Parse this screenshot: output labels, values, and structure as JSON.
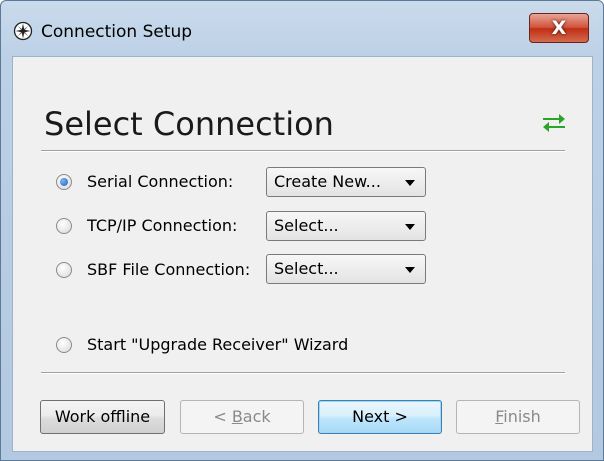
{
  "window": {
    "title": "Connection Setup",
    "close_label": "X",
    "heading": "Select Connection"
  },
  "icons": {
    "app": "compass-rose-icon",
    "swap": "swap-arrows-icon",
    "swap_color": "#2aa52a"
  },
  "options": [
    {
      "label": "Serial Connection:",
      "selected": true,
      "combo_value": "Create New..."
    },
    {
      "label": "TCP/IP Connection:",
      "selected": false,
      "combo_value": "Select..."
    },
    {
      "label": "SBF File Connection:",
      "selected": false,
      "combo_value": "Select..."
    },
    {
      "label": "Start \"Upgrade Receiver\" Wizard",
      "selected": false
    }
  ],
  "buttons": {
    "work_offline": "Work offline",
    "back_prefix": "< ",
    "back_mnemonic": "B",
    "back_rest": "ack",
    "next": "Next >",
    "finish_mnemonic": "F",
    "finish_rest": "inish"
  }
}
